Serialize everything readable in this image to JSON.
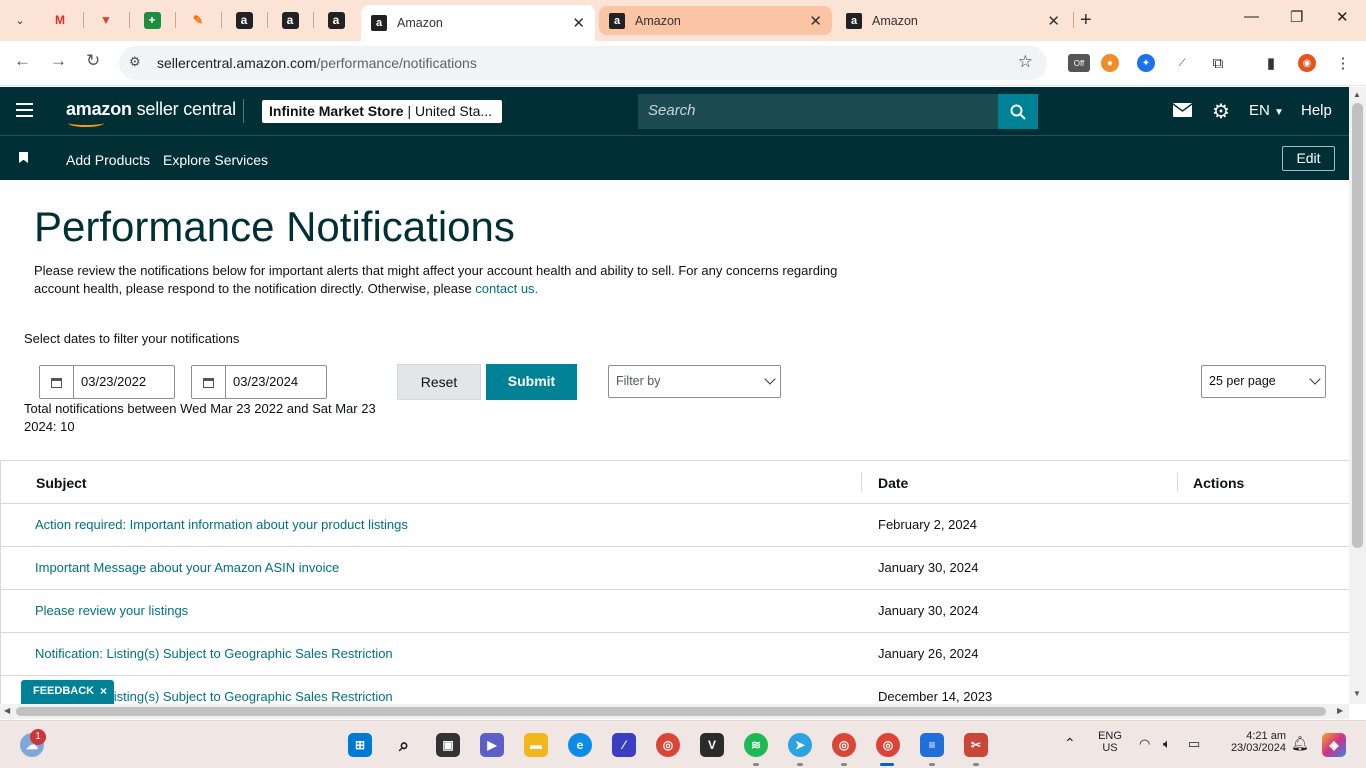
{
  "browser": {
    "tabs": [
      {
        "title": "Amazon",
        "state": "active"
      },
      {
        "title": "Amazon",
        "state": "highlighted"
      },
      {
        "title": "Amazon",
        "state": "normal"
      }
    ],
    "url_domain": "sellercentral.amazon.com",
    "url_path": "/performance/notifications",
    "extension_badge": "Off"
  },
  "header": {
    "logo_bold": "amazon",
    "logo_rest": " seller central",
    "store_name": "Infinite Market Store",
    "store_region": " | United Sta...",
    "search_placeholder": "Search",
    "language": "EN",
    "help": "Help"
  },
  "subnav": {
    "links": [
      "Add Products",
      "Explore Services"
    ],
    "edit": "Edit"
  },
  "page": {
    "title": "Performance Notifications",
    "intro_text": "Please review the notifications below for important alerts that might affect your account health and ability to sell. For any concerns regarding account health, please respond to the notification directly. Otherwise, please ",
    "intro_link": "contact us.",
    "filter_label": "Select dates to filter your notifications",
    "start_date": "03/23/2022",
    "end_date": "03/23/2024",
    "reset_label": "Reset",
    "submit_label": "Submit",
    "filter_by": "Filter by",
    "per_page": "25 per page",
    "total": "Total notifications between Wed Mar 23 2022 and Sat Mar 23 2024: 10"
  },
  "table": {
    "headers": {
      "subject": "Subject",
      "date": "Date",
      "actions": "Actions"
    },
    "rows": [
      {
        "subject": "Action required: Important information about your product listings",
        "date": "February 2, 2024"
      },
      {
        "subject": "Important Message about your Amazon ASIN invoice",
        "date": "January 30, 2024"
      },
      {
        "subject": "Please review your listings",
        "date": "January 30, 2024"
      },
      {
        "subject": "Notification: Listing(s) Subject to Geographic Sales Restriction",
        "date": "January 26, 2024"
      },
      {
        "subject": "Notification: Listing(s) Subject to Geographic Sales Restriction",
        "date": "December 14, 2023"
      }
    ]
  },
  "feedback": {
    "label": "FEEDBACK",
    "close": "×"
  },
  "taskbar": {
    "weather_badge": "1",
    "lang_line1": "ENG",
    "lang_line2": "US",
    "time": "4:21 am",
    "date": "23/03/2024"
  },
  "colors": {
    "header_bg": "#002f36",
    "teal": "#008296",
    "link": "#007185",
    "tab_strip": "#fbe3d6"
  }
}
